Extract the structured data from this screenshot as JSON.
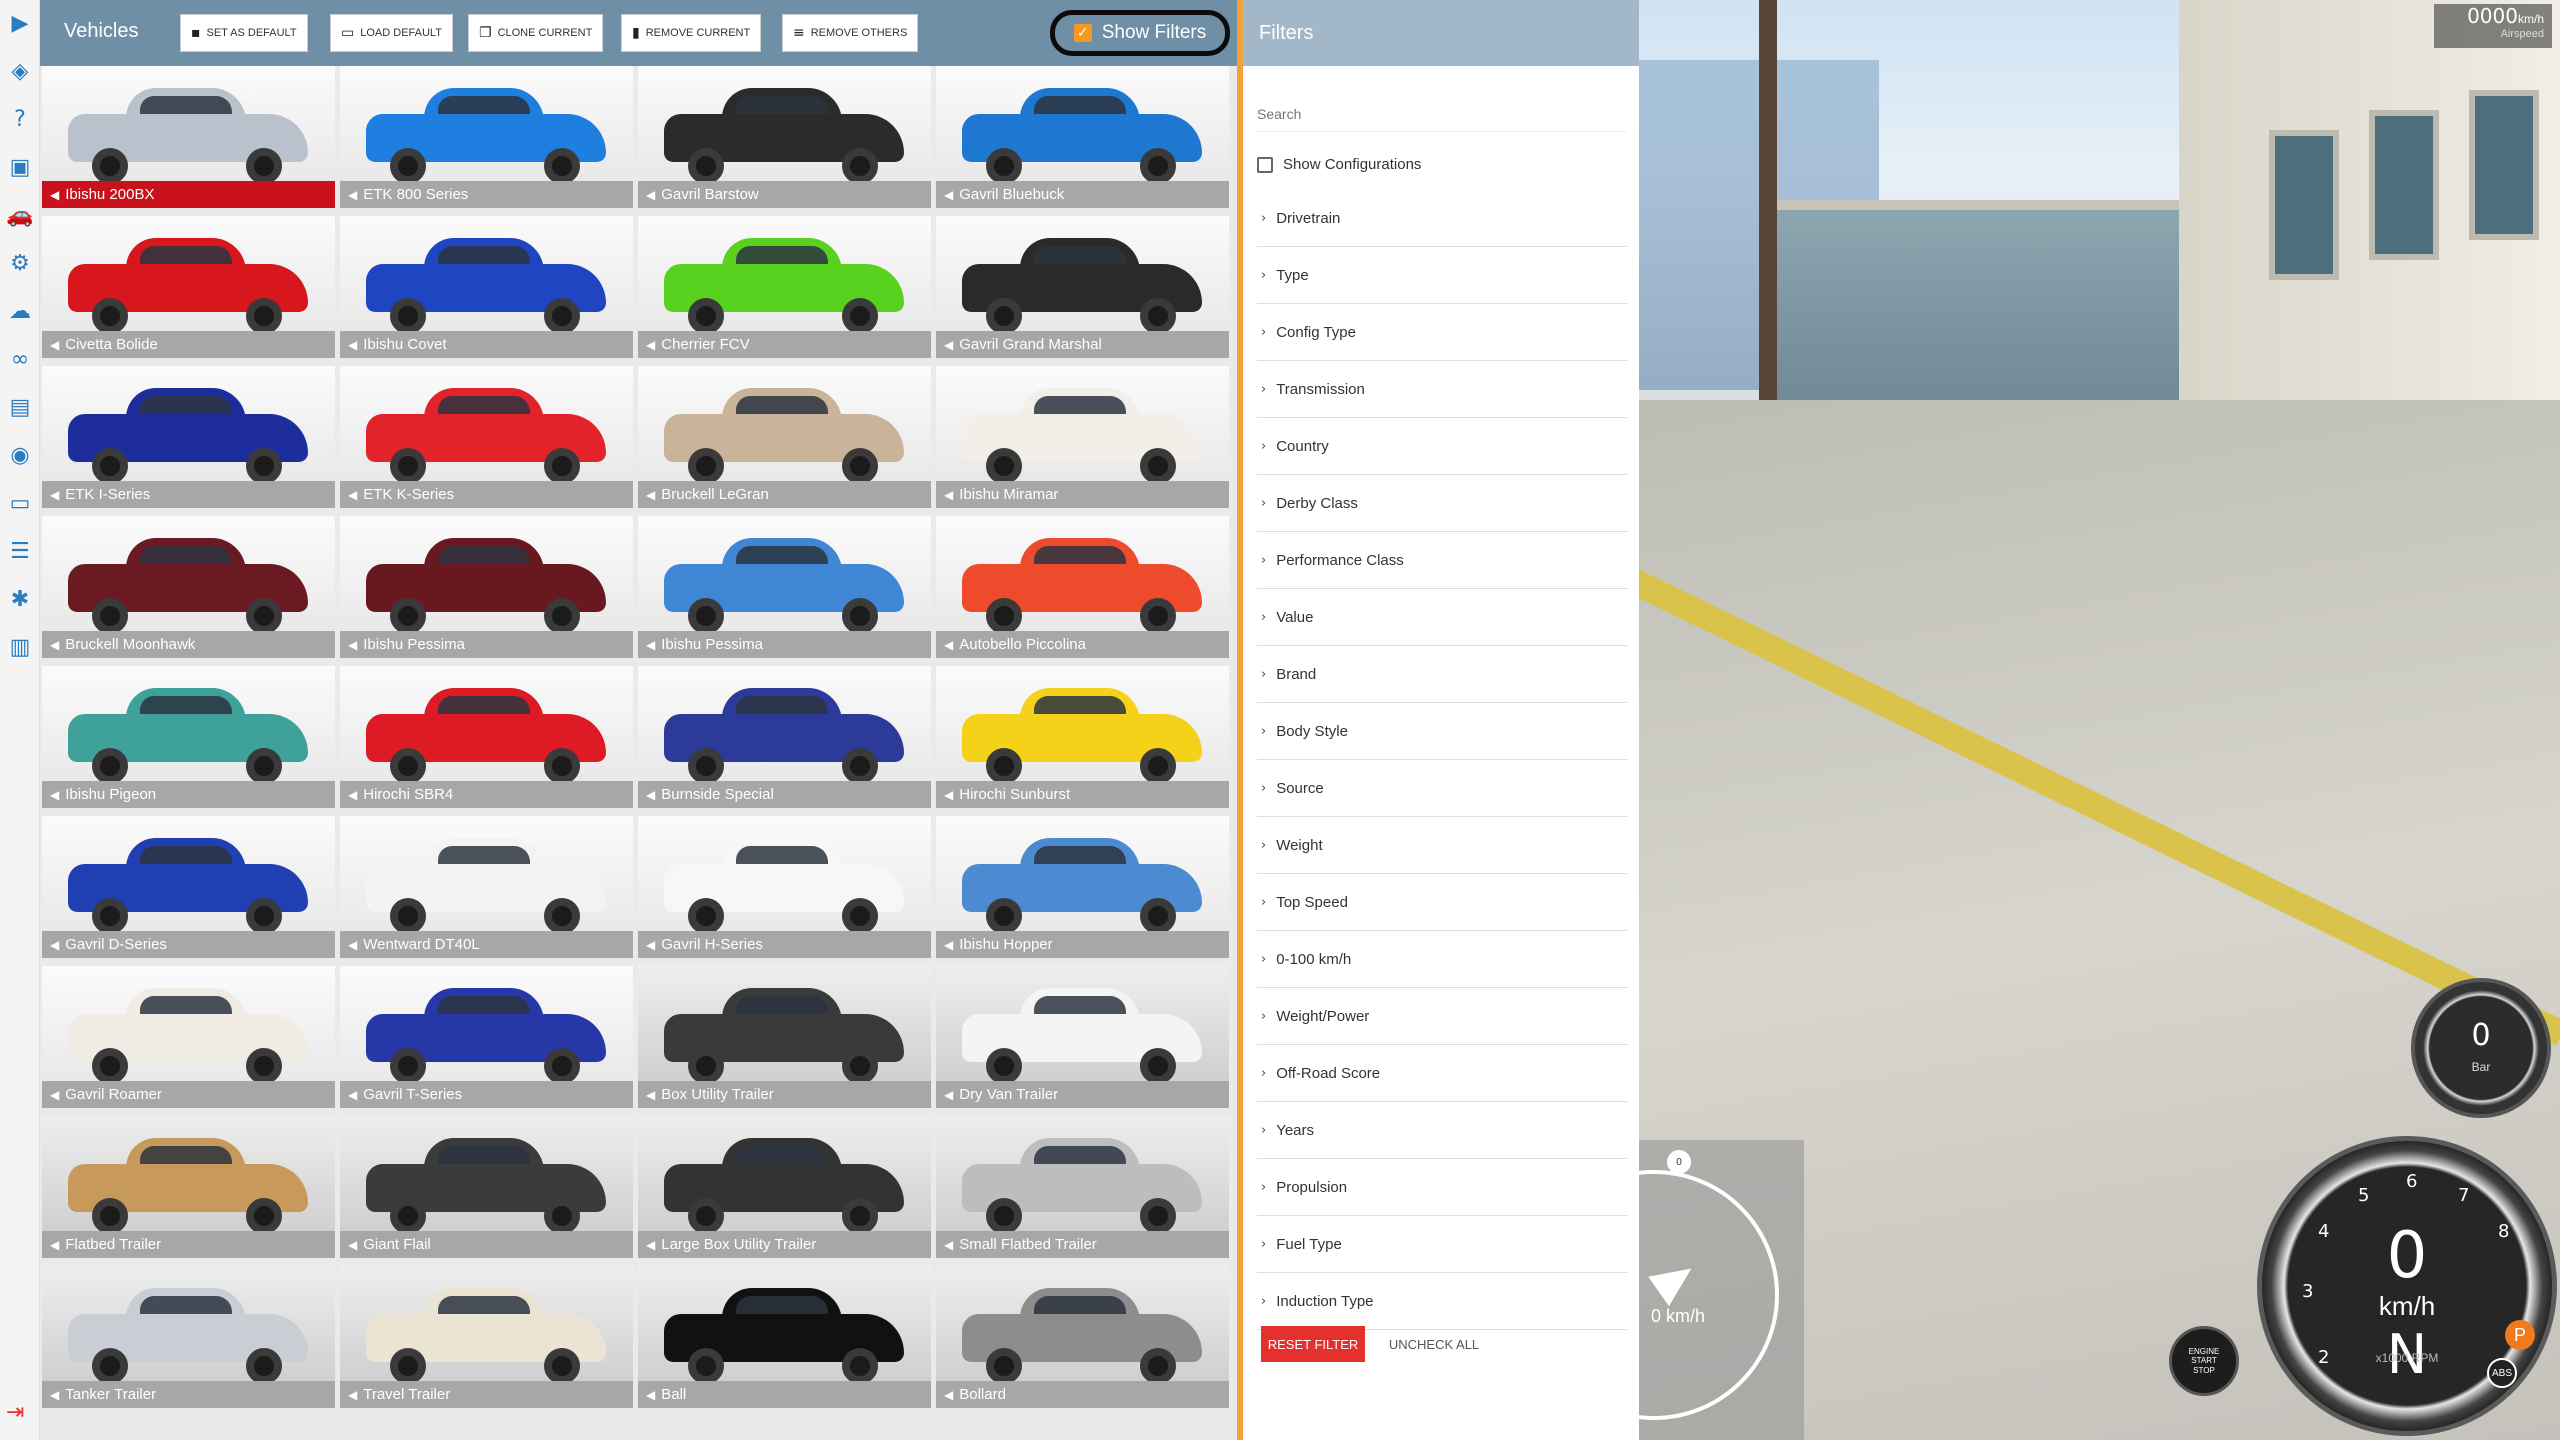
{
  "sidebar": {
    "icons": [
      {
        "name": "play-icon",
        "glyph": "▶"
      },
      {
        "name": "layers-icon",
        "glyph": "◈"
      },
      {
        "name": "help-icon",
        "glyph": "?"
      },
      {
        "name": "media-icon",
        "glyph": "▣"
      },
      {
        "name": "car-icon",
        "glyph": "🚗"
      },
      {
        "name": "settings-icon",
        "glyph": "⚙"
      },
      {
        "name": "cloud-icon",
        "glyph": "☁"
      },
      {
        "name": "infinity-icon",
        "glyph": "∞"
      },
      {
        "name": "film-icon",
        "glyph": "▤"
      },
      {
        "name": "camera-icon",
        "glyph": "◉"
      },
      {
        "name": "window-icon",
        "glyph": "▭"
      },
      {
        "name": "sliders-icon",
        "glyph": "☰"
      },
      {
        "name": "bug-icon",
        "glyph": "✱"
      },
      {
        "name": "chart-icon",
        "glyph": "▥"
      }
    ],
    "exit_glyph": "⇥"
  },
  "vehicles_panel": {
    "title": "Vehicles",
    "toolbar": {
      "set_default": "SET AS DEFAULT",
      "load_default": "LOAD DEFAULT",
      "clone_current": "CLONE CURRENT",
      "remove_current": "REMOVE CURRENT",
      "remove_others": "REMOVE OTHERS",
      "show_filters": "Show Filters"
    },
    "tiles": [
      {
        "name": "Ibishu 200BX",
        "color": "#b9c2cc",
        "selected": true
      },
      {
        "name": "ETK 800 Series",
        "color": "#1f7fe0"
      },
      {
        "name": "Gavril Barstow",
        "color": "#2b2b2b"
      },
      {
        "name": "Gavril Bluebuck",
        "color": "#1e78d2"
      },
      {
        "name": "Civetta Bolide",
        "color": "#d8161d"
      },
      {
        "name": "Ibishu Covet",
        "color": "#1f45c2"
      },
      {
        "name": "Cherrier FCV",
        "color": "#58d21e"
      },
      {
        "name": "Gavril Grand Marshal",
        "color": "#2a2a2a"
      },
      {
        "name": "ETK I-Series",
        "color": "#1d2e9c"
      },
      {
        "name": "ETK K-Series",
        "color": "#e2232a"
      },
      {
        "name": "Bruckell LeGran",
        "color": "#c9b49a"
      },
      {
        "name": "Ibishu Miramar",
        "color": "#f1efe7"
      },
      {
        "name": "Bruckell Moonhawk",
        "color": "#6b1a22"
      },
      {
        "name": "Ibishu Pessima",
        "color": "#6a1820"
      },
      {
        "name": "Ibishu Pessima",
        "color": "#3f86d4"
      },
      {
        "name": "Autobello Piccolina",
        "color": "#ee4a2c"
      },
      {
        "name": "Ibishu Pigeon",
        "color": "#3ea19a"
      },
      {
        "name": "Hirochi SBR4",
        "color": "#de1b24"
      },
      {
        "name": "Burnside Special",
        "color": "#2c3a9a"
      },
      {
        "name": "Hirochi Sunburst",
        "color": "#f4d21a"
      },
      {
        "name": "Gavril D-Series",
        "color": "#1f3fb3"
      },
      {
        "name": "Wentward DT40L",
        "color": "#f3f3f3"
      },
      {
        "name": "Gavril H-Series",
        "color": "#f7f7f7"
      },
      {
        "name": "Ibishu Hopper",
        "color": "#4c8ad1"
      },
      {
        "name": "Gavril Roamer",
        "color": "#f0ece3"
      },
      {
        "name": "Gavril T-Series",
        "color": "#2638a8"
      },
      {
        "name": "Box Utility Trailer",
        "color": "#3a3a3a",
        "trailer": true
      },
      {
        "name": "Dry Van Trailer",
        "color": "#f4f4f4",
        "trailer": true
      },
      {
        "name": "Flatbed Trailer",
        "color": "#c79a5b",
        "trailer": true
      },
      {
        "name": "Giant Flail",
        "color": "#3b3b3b",
        "trailer": true
      },
      {
        "name": "Large Box Utility Trailer",
        "color": "#333333",
        "trailer": true
      },
      {
        "name": "Small Flatbed Trailer",
        "color": "#bdbdbd",
        "trailer": true
      },
      {
        "name": "Tanker Trailer",
        "color": "#c8ced4",
        "trailer": true
      },
      {
        "name": "Travel Trailer",
        "color": "#ece4d2",
        "trailer": true
      },
      {
        "name": "Ball",
        "color": "#111111",
        "trailer": true
      },
      {
        "name": "Bollard",
        "color": "#8d8d8d",
        "trailer": true
      }
    ]
  },
  "filters_panel": {
    "title": "Filters",
    "search_placeholder": "Search",
    "show_configurations": "Show Configurations",
    "categories": [
      "Drivetrain",
      "Type",
      "Config Type",
      "Transmission",
      "Country",
      "Derby Class",
      "Performance Class",
      "Value",
      "Brand",
      "Body Style",
      "Source",
      "Weight",
      "Top Speed",
      "0-100 km/h",
      "Weight/Power",
      "Off-Road Score",
      "Years",
      "Propulsion",
      "Fuel Type",
      "Induction Type"
    ],
    "reset_filter": "RESET FILTER",
    "uncheck_all": "UNCHECK ALL",
    "accent_color": "#e5312e"
  },
  "hud": {
    "airspeed_value": "0000",
    "airspeed_unit": "km/h",
    "airspeed_label": "Airspeed",
    "speedo_knob": "0",
    "speedo_text": "0 km/h",
    "boost_value": "0",
    "boost_unit": "Bar",
    "tach_speed": "0",
    "tach_unit": "km/h",
    "tach_gear": "N",
    "tach_rpm_label": "x1000 RPM",
    "tach_marks": [
      "2",
      "3",
      "4",
      "5",
      "6",
      "7",
      "8"
    ],
    "engine_line1": "ENGINE",
    "engine_line2": "START",
    "engine_line3": "STOP",
    "park_label": "P",
    "abs_label": "ABS"
  }
}
